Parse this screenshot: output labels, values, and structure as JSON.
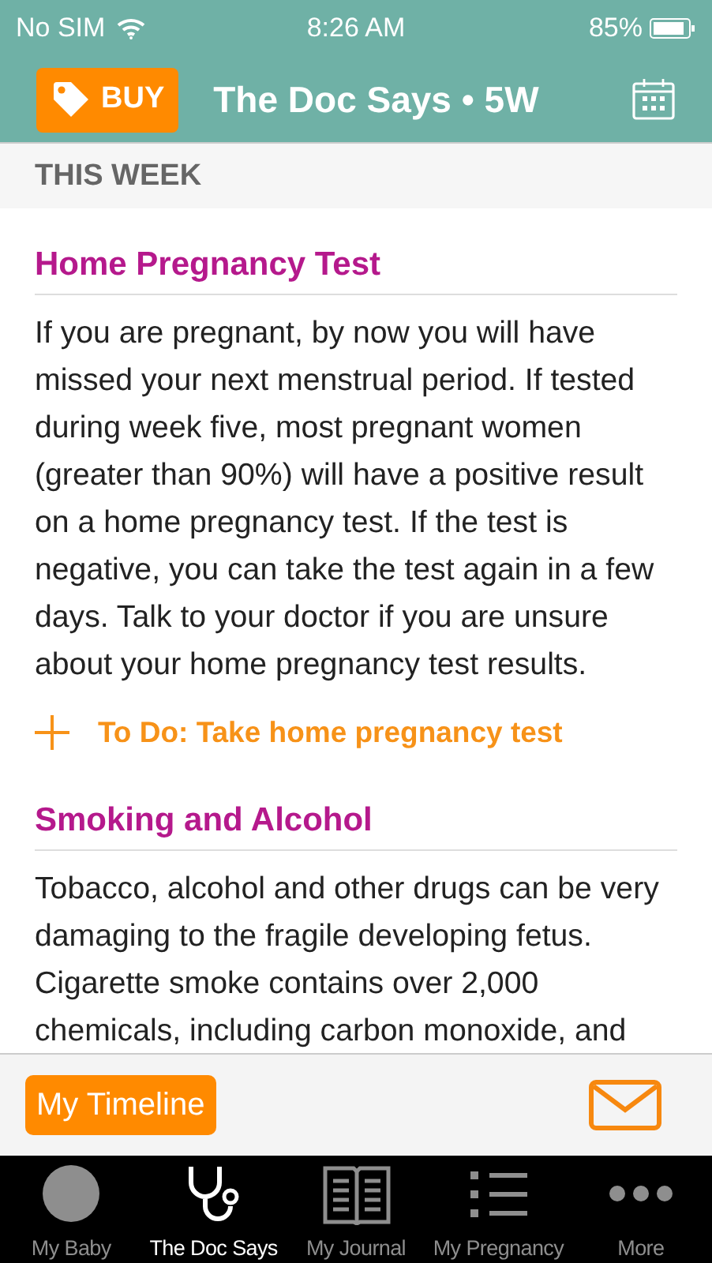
{
  "status_bar": {
    "carrier": "No SIM",
    "time": "8:26 AM",
    "battery": "85%"
  },
  "header": {
    "buy_label": "BUY",
    "title": "The Doc Says • 5W"
  },
  "section_label": "THIS WEEK",
  "articles": [
    {
      "title": "Home Pregnancy Test",
      "body": "If you are pregnant, by now you will have missed your next menstrual period. If tested during week five, most pregnant women (greater than 90%) will have a positive result on a home pregnancy test. If the test is negative, you can take the test again in a few days. Talk to your doctor if you are unsure about your home pregnancy test results.",
      "todo": "To Do: Take home pregnancy test"
    },
    {
      "title": "Smoking and Alcohol",
      "body": "Tobacco, alcohol and other drugs can be very damaging to the fragile developing fetus. Cigarette smoke contains over 2,000 chemicals, including carbon monoxide, and"
    }
  ],
  "timeline_button": "My Timeline",
  "tabs": [
    {
      "kind": "baby",
      "label": "My Baby",
      "selected": false
    },
    {
      "kind": "stethoscope",
      "label": "The Doc Says",
      "selected": true
    },
    {
      "kind": "journal",
      "label": "My Journal",
      "selected": false
    },
    {
      "kind": "list",
      "label": "My Pregnancy",
      "selected": false
    },
    {
      "kind": "more",
      "label": "More",
      "selected": false
    }
  ]
}
